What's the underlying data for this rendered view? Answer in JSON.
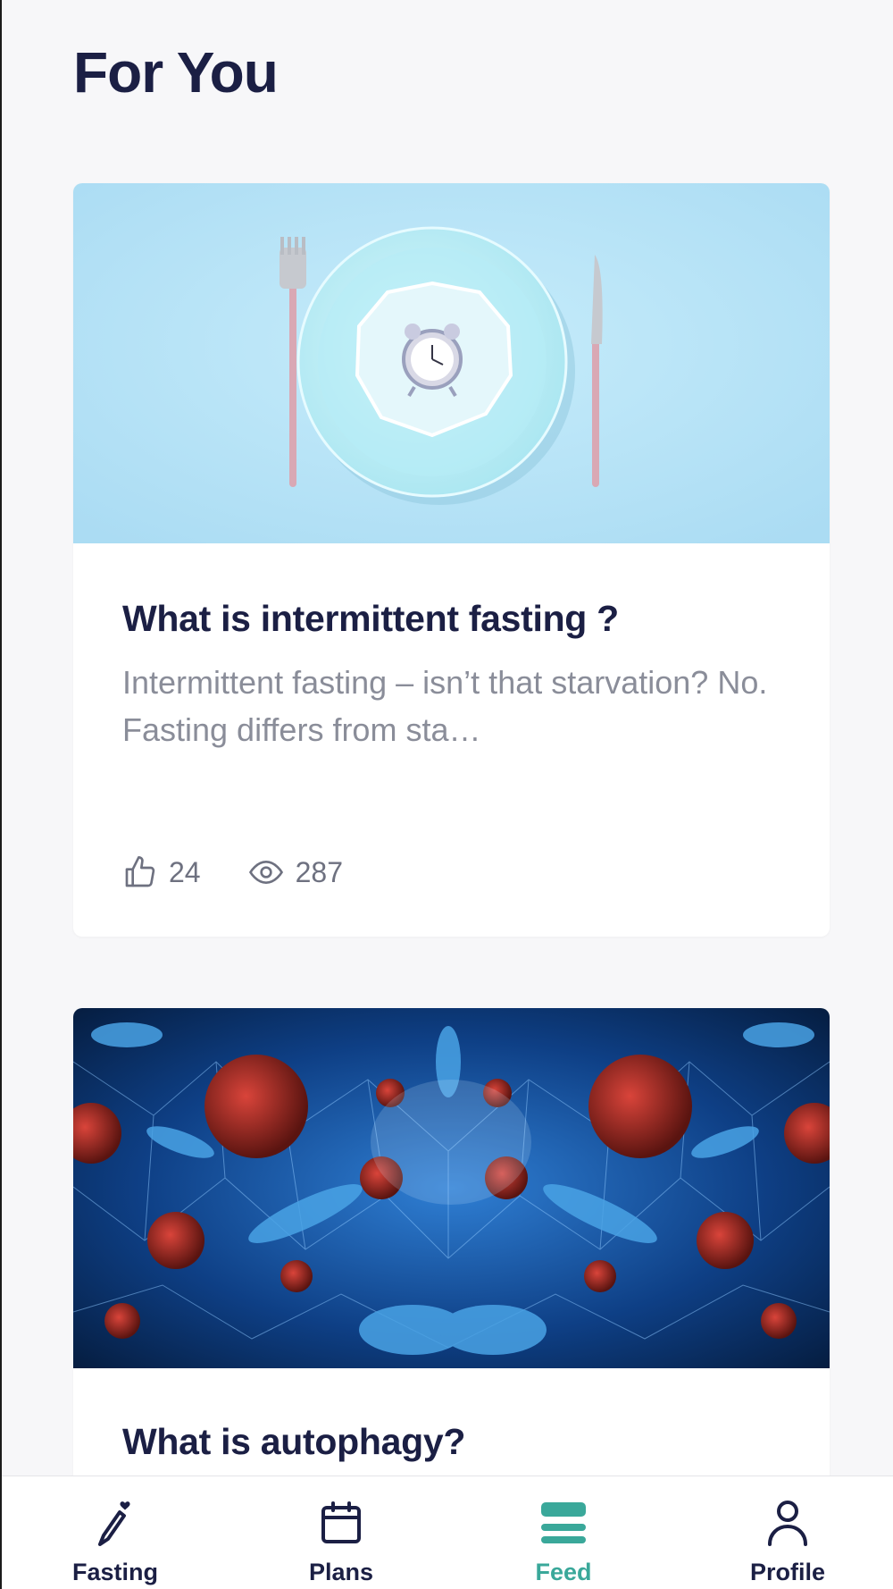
{
  "header": {
    "title": "For You"
  },
  "feed": {
    "cards": [
      {
        "title": "What is intermittent fasting ?",
        "excerpt": "Intermittent fasting – isn’t that starvation? No. Fasting differs from sta…",
        "likes": "24",
        "views": "287",
        "image": "plate-with-alarm-clock"
      },
      {
        "title": "What is autophagy?",
        "image": "virus-cells-network"
      }
    ]
  },
  "tabbar": {
    "items": [
      {
        "label": "Fasting",
        "icon": "fasting-icon",
        "active": false
      },
      {
        "label": "Plans",
        "icon": "calendar-icon",
        "active": false
      },
      {
        "label": "Feed",
        "icon": "feed-icon",
        "active": true
      },
      {
        "label": "Profile",
        "icon": "profile-icon",
        "active": false
      }
    ]
  },
  "colors": {
    "title": "#1b1f44",
    "muted": "#8a8d99",
    "accent": "#3aa89a",
    "background": "#f7f7f9"
  }
}
